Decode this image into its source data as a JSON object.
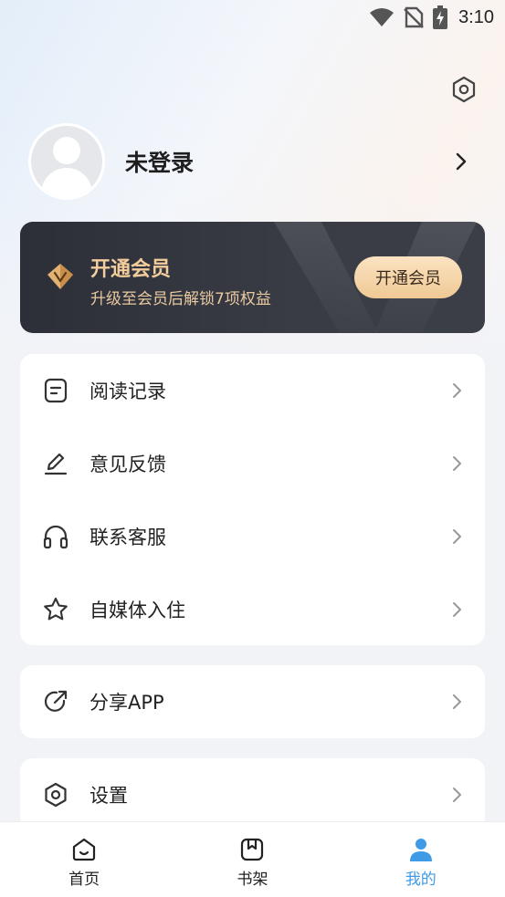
{
  "status_bar": {
    "time": "3:10"
  },
  "profile": {
    "name": "未登录"
  },
  "vip": {
    "title": "开通会员",
    "subtitle": "升级至会员后解锁7项权益",
    "button": "开通会员"
  },
  "menu_group_1": [
    {
      "label": "阅读记录",
      "icon": "document-icon"
    },
    {
      "label": "意见反馈",
      "icon": "edit-icon"
    },
    {
      "label": "联系客服",
      "icon": "headphones-icon"
    },
    {
      "label": "自媒体入住",
      "icon": "star-icon"
    }
  ],
  "menu_group_2": [
    {
      "label": "分享APP",
      "icon": "share-icon"
    }
  ],
  "menu_group_3": [
    {
      "label": "设置",
      "icon": "settings-icon"
    }
  ],
  "bottom_nav": [
    {
      "label": "首页",
      "icon": "home-icon",
      "active": false
    },
    {
      "label": "书架",
      "icon": "bookshelf-icon",
      "active": false
    },
    {
      "label": "我的",
      "icon": "profile-icon",
      "active": true
    }
  ],
  "colors": {
    "accent": "#3f9be6",
    "vip_gold": "#f3cd9c",
    "vip_bg": "#2c2f37"
  }
}
